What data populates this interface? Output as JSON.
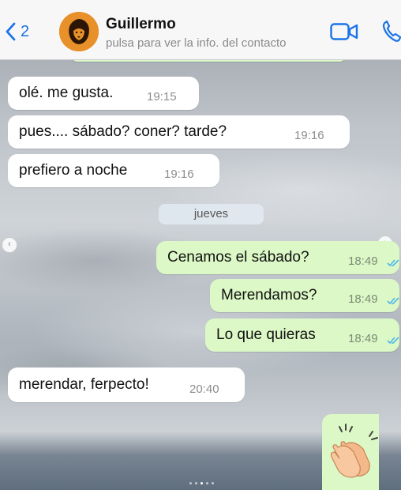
{
  "header": {
    "back_count": "2",
    "contact_name": "Guillermo",
    "contact_subtitle": "pulsa para ver la info. del contacto"
  },
  "date_separator": "jueves",
  "messages": [
    {
      "text": "olé. me gusta.",
      "time": "19:15",
      "direction": "in"
    },
    {
      "text": "pues.... sábado? coner? tarde?",
      "time": "19:16",
      "direction": "in"
    },
    {
      "text": "prefiero a noche",
      "time": "19:16",
      "direction": "in"
    },
    {
      "text": "Cenamos el sábado?",
      "time": "18:49",
      "direction": "out",
      "status": "read"
    },
    {
      "text": "Merendamos?",
      "time": "18:49",
      "direction": "out",
      "status": "read"
    },
    {
      "text": "Lo que quieras",
      "time": "18:49",
      "direction": "out",
      "status": "read"
    },
    {
      "text": "merendar, ferpecto!",
      "time": "20:40",
      "direction": "in"
    }
  ],
  "sticker": {
    "icon": "clapping-hands-icon"
  },
  "colors": {
    "accent": "#1a73e8",
    "outgoing_bubble": "#dcf8c6",
    "incoming_bubble": "#ffffff",
    "read_ticks": "#4fb6ec"
  }
}
